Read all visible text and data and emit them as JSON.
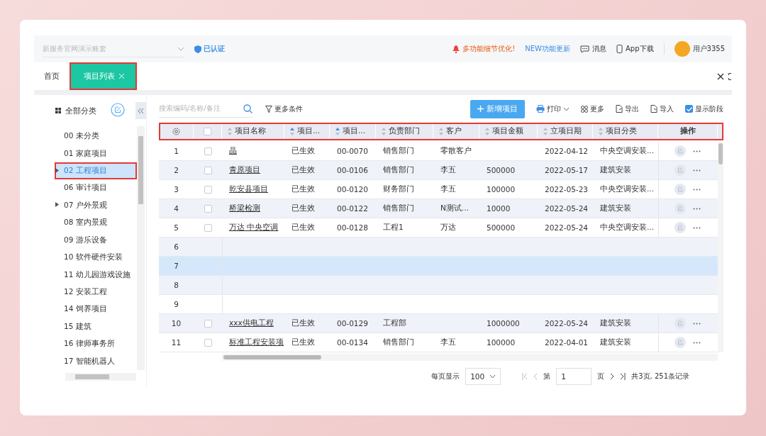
{
  "top_bar": {
    "account_select": {
      "placeholder": "新服务官网演示账套"
    },
    "verified": "已认证",
    "notice": "多功能细节优化!",
    "update_link": "NEW功能更新",
    "messages": "消息",
    "app_download": "App下载",
    "user": "用户3355"
  },
  "tabs": [
    {
      "label": "首页",
      "selected": false,
      "highlighted": false,
      "closable": false
    },
    {
      "label": "项目列表",
      "selected": true,
      "highlighted": true,
      "closable": true
    }
  ],
  "sidebar": {
    "title": "全部分类",
    "items": [
      {
        "label": "00 未分类",
        "selected": false,
        "highlighted": false
      },
      {
        "label": "01 家庭项目",
        "selected": false,
        "highlighted": false
      },
      {
        "label": "02 工程项目",
        "selected": true,
        "highlighted": true,
        "expanded": false
      },
      {
        "label": "06 审计项目",
        "selected": false,
        "highlighted": false
      },
      {
        "label": "07 户外景观",
        "selected": false,
        "highlighted": false,
        "expanded": false
      },
      {
        "label": "08 室内景观",
        "selected": false,
        "highlighted": false
      },
      {
        "label": "09 游乐设备",
        "selected": false,
        "highlighted": false
      },
      {
        "label": "10 软件硬件安装",
        "selected": false,
        "highlighted": false
      },
      {
        "label": "11 幼儿园游戏设施",
        "selected": false,
        "highlighted": false
      },
      {
        "label": "12 安装工程",
        "selected": false,
        "highlighted": false
      },
      {
        "label": "14 饲养项目",
        "selected": false,
        "highlighted": false
      },
      {
        "label": "15 建筑",
        "selected": false,
        "highlighted": false
      },
      {
        "label": "16 律师事务所",
        "selected": false,
        "highlighted": false
      },
      {
        "label": "17 智能机器人",
        "selected": false,
        "highlighted": false
      }
    ]
  },
  "toolbar": {
    "search": {
      "placeholder": "搜索编码/名称/备注"
    },
    "filter": "更多条件",
    "add_button": "新增项目",
    "print": "打印",
    "more": "更多",
    "export": "导出",
    "import": "导入",
    "show_stage": {
      "label": "显示阶段",
      "checked": true
    }
  },
  "table": {
    "highlighted": true,
    "columns": [
      {
        "label": "项目名称",
        "sort_active": false
      },
      {
        "label": "项目...",
        "sort_active": true
      },
      {
        "label": "项目...",
        "sort_active": true
      },
      {
        "label": "负责部门",
        "sort_active": false
      },
      {
        "label": "客户",
        "sort_active": false
      },
      {
        "label": "项目金额",
        "sort_active": false
      },
      {
        "label": "立项日期",
        "sort_active": false
      },
      {
        "label": "项目分类",
        "sort_active": false
      }
    ],
    "action_header": "操作",
    "rows": [
      {
        "index": "1",
        "selected": false,
        "checked": false,
        "cells": [
          "晶",
          "已生效",
          "00-0070",
          "销售部门",
          "零散客户",
          "",
          "2022-04-12",
          "中央空调安装..."
        ]
      },
      {
        "index": "2",
        "selected": false,
        "checked": false,
        "cells": [
          "青原项目",
          "已生效",
          "00-0106",
          "销售部门",
          "李五",
          "500000",
          "2022-05-17",
          "建筑安装"
        ]
      },
      {
        "index": "3",
        "selected": false,
        "checked": false,
        "cells": [
          "乾安县项目",
          "已生效",
          "00-0120",
          "财务部门",
          "李五",
          "100000",
          "2022-05-23",
          "中央空调安装..."
        ]
      },
      {
        "index": "4",
        "selected": false,
        "checked": false,
        "cells": [
          "桥梁检测",
          "已生效",
          "00-0122",
          "销售部门",
          "N测试...",
          "10000",
          "2022-05-24",
          "建筑安装"
        ]
      },
      {
        "index": "5",
        "selected": false,
        "checked": false,
        "cells": [
          "万达 中央空调",
          "已生效",
          "00-0128",
          "工程1",
          "万达",
          "500000",
          "2022-05-24",
          "中央空调安装..."
        ]
      },
      {
        "index": "6",
        "selected": false
      },
      {
        "index": "7",
        "selected": true
      },
      {
        "index": "8",
        "selected": false
      },
      {
        "index": "9",
        "selected": false
      },
      {
        "index": "10",
        "selected": false,
        "checked": false,
        "cells": [
          "xxx供电工程",
          "已生效",
          "00-0129",
          "工程部",
          "",
          "1000000",
          "2022-05-24",
          "建筑安装"
        ]
      },
      {
        "index": "11",
        "selected": false,
        "checked": false,
        "cells": [
          "标准工程安装项",
          "已生效",
          "00-0134",
          "销售部门",
          "李五",
          "100000",
          "2022-04-01",
          "建筑安装"
        ]
      }
    ]
  },
  "pagination": {
    "page_size_label": "每页显示",
    "page_size": "100",
    "page_prefix": "第",
    "page": "1",
    "page_suffix": "页",
    "summary": "共3页, 251条记录"
  }
}
